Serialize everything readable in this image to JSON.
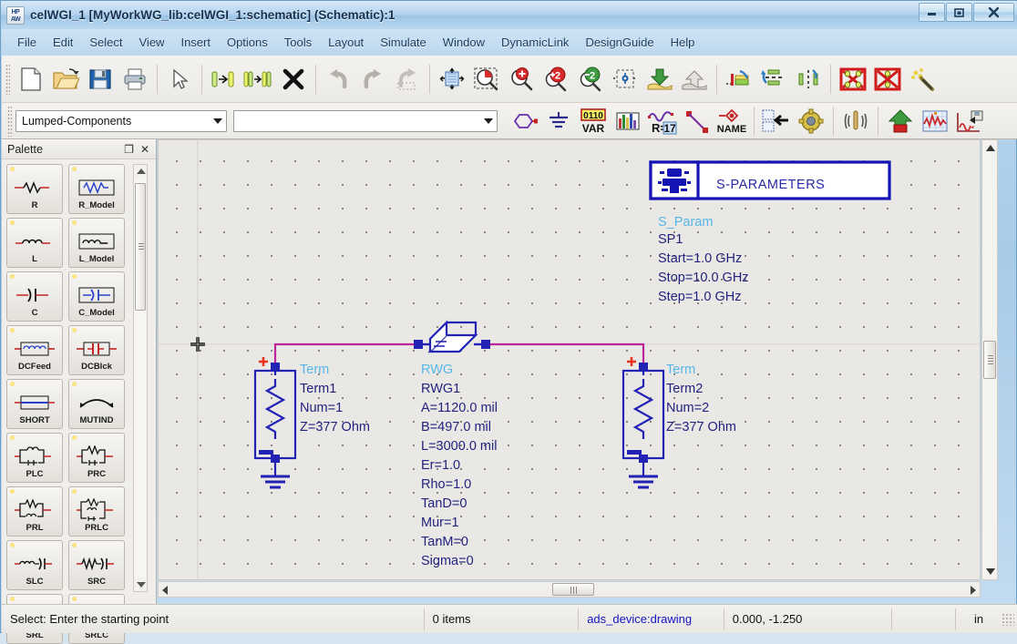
{
  "window": {
    "title": "celWGI_1 [MyWorkWG_lib:celWGI_1:schematic] (Schematic):1",
    "icon_label": "HP\nAW",
    "minimize": "—",
    "maximize": "□",
    "close": "✕"
  },
  "menu": {
    "items": [
      {
        "label": "File"
      },
      {
        "label": "Edit"
      },
      {
        "label": "Select"
      },
      {
        "label": "View"
      },
      {
        "label": "Insert"
      },
      {
        "label": "Options"
      },
      {
        "label": "Tools"
      },
      {
        "label": "Layout"
      },
      {
        "label": "Simulate"
      },
      {
        "label": "Window"
      },
      {
        "label": "DynamicLink"
      },
      {
        "label": "DesignGuide"
      },
      {
        "label": "Help"
      }
    ]
  },
  "toolbar_main": {
    "buttons": [
      {
        "name": "new-document-icon"
      },
      {
        "name": "open-folder-icon"
      },
      {
        "name": "save-icon"
      },
      {
        "name": "print-icon"
      },
      {
        "sep": true
      },
      {
        "name": "select-arrow-icon"
      },
      {
        "sep": true
      },
      {
        "name": "insert-pin-icon"
      },
      {
        "name": "insert-multi-pin-icon"
      },
      {
        "name": "delete-x-icon"
      },
      {
        "sep": true
      },
      {
        "name": "undo-icon"
      },
      {
        "name": "redo-icon"
      },
      {
        "name": "redraw-icon"
      },
      {
        "sep": true
      },
      {
        "name": "zoom-fit-icon"
      },
      {
        "name": "zoom-area-icon"
      },
      {
        "name": "zoom-in-icon"
      },
      {
        "name": "zoom-in-2x-icon"
      },
      {
        "name": "zoom-out-2x-icon"
      },
      {
        "name": "snap-icon"
      },
      {
        "name": "push-into-hierarchy-icon"
      },
      {
        "name": "pop-out-hierarchy-icon"
      },
      {
        "sep": true
      },
      {
        "name": "wire-label-icon"
      },
      {
        "name": "align-icon"
      },
      {
        "name": "mirror-icon"
      },
      {
        "sep": true
      },
      {
        "name": "deactivate-icon"
      },
      {
        "name": "activate-icon"
      },
      {
        "name": "tune-icon"
      }
    ]
  },
  "toolbar_palette": {
    "library_combo": {
      "value": "Lumped-Components",
      "placeholder": ""
    },
    "component_combo": {
      "value": "",
      "placeholder": ""
    },
    "buttons": [
      {
        "name": "port-icon"
      },
      {
        "name": "ground-icon"
      },
      {
        "name": "var-icon",
        "label_top": "0110",
        "label_bottom": "VAR"
      },
      {
        "name": "data-items-icon"
      },
      {
        "name": "set-parameter-icon",
        "label": "R=17"
      },
      {
        "name": "wire-icon"
      },
      {
        "name": "wire-name-icon",
        "label": "NAME"
      },
      {
        "sep": true
      },
      {
        "name": "copy-paste-icon"
      },
      {
        "name": "simulation-settings-icon"
      },
      {
        "sep": true
      },
      {
        "name": "tune-parameters-icon"
      },
      {
        "sep": true
      },
      {
        "name": "simulate-icon"
      },
      {
        "name": "display-results-icon"
      },
      {
        "name": "data-display-icon"
      }
    ]
  },
  "palette": {
    "title": "Palette",
    "undock_icon": "❐",
    "close_icon": "✕",
    "items": [
      {
        "label": "R",
        "glyph": "resistor"
      },
      {
        "label": "R_Model",
        "glyph": "resistor-box"
      },
      {
        "label": "L",
        "glyph": "inductor"
      },
      {
        "label": "L_Model",
        "glyph": "inductor-box"
      },
      {
        "label": "C",
        "glyph": "capacitor"
      },
      {
        "label": "C_Model",
        "glyph": "capacitor-box"
      },
      {
        "label": "DCFeed",
        "glyph": "dcfeed"
      },
      {
        "label": "DCBlck",
        "glyph": "dcblock"
      },
      {
        "label": "SHORT",
        "glyph": "short"
      },
      {
        "label": "MUTIND",
        "glyph": "mutind"
      },
      {
        "label": "PLC",
        "glyph": "plc"
      },
      {
        "label": "PRC",
        "glyph": "prc"
      },
      {
        "label": "PRL",
        "glyph": "prl"
      },
      {
        "label": "PRLC",
        "glyph": "prlc"
      },
      {
        "label": "SLC",
        "glyph": "slc"
      },
      {
        "label": "SRC",
        "glyph": "src"
      },
      {
        "label": "SRL",
        "glyph": "srl"
      },
      {
        "label": "SRLC",
        "glyph": "srlc"
      }
    ]
  },
  "schematic": {
    "sparam_box": {
      "title": "S-PARAMETERS",
      "lines": [
        {
          "text": "S_Param",
          "style": "cyan"
        },
        {
          "text": "SP1",
          "style": "dk"
        },
        {
          "text": "Start=1.0 GHz",
          "style": "dk"
        },
        {
          "text": "Stop=10.0 GHz",
          "style": "dk"
        },
        {
          "text": "Step=1.0 GHz",
          "style": "dk"
        }
      ]
    },
    "rwg": {
      "lines": [
        {
          "text": "RWG",
          "style": "cyan"
        },
        {
          "text": "RWG1",
          "style": "dk"
        },
        {
          "text": "A=1120.0 mil",
          "style": "dk"
        },
        {
          "text": "B=497.0 mil",
          "style": "dk"
        },
        {
          "text": "L=3000.0 mil",
          "style": "dk"
        },
        {
          "text": "Er=1.0",
          "style": "dk"
        },
        {
          "text": "Rho=1.0",
          "style": "dk"
        },
        {
          "text": "TanD=0",
          "style": "dk"
        },
        {
          "text": "Mur=1",
          "style": "dk"
        },
        {
          "text": "TanM=0",
          "style": "dk"
        },
        {
          "text": "Sigma=0",
          "style": "dk"
        }
      ]
    },
    "term1": {
      "lines": [
        {
          "text": "Term",
          "style": "cyan"
        },
        {
          "text": "Term1",
          "style": "dk"
        },
        {
          "text": "Num=1",
          "style": "dk"
        },
        {
          "text": "Z=377 Ohm",
          "style": "dk"
        }
      ]
    },
    "term2": {
      "lines": [
        {
          "text": "Term",
          "style": "cyan"
        },
        {
          "text": "Term2",
          "style": "dk"
        },
        {
          "text": "Num=2",
          "style": "dk"
        },
        {
          "text": "Z=377 Ohm",
          "style": "dk"
        }
      ]
    }
  },
  "statusbar": {
    "message": "Select: Enter the starting point",
    "items": "0 items",
    "layer": "ads_device:drawing",
    "coordinates": "0.000, -1.250",
    "blank": "",
    "units": "in"
  },
  "colors": {
    "schematic_wire": "#c0249a",
    "schematic_component": "#2222b4",
    "schematic_label_cyan": "#55b8e8",
    "canvas_bg": "#eae8e5",
    "accent_blue": "#1414c8"
  }
}
